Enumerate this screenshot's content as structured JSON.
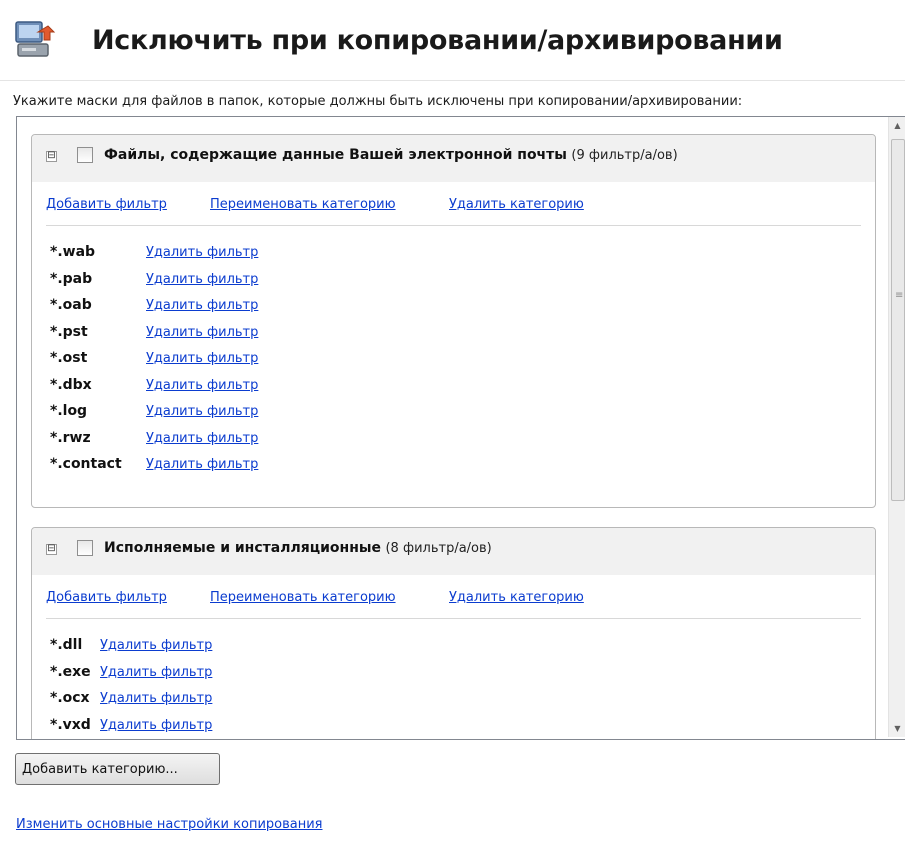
{
  "header": {
    "title": "Исключить при копировании/архивировании",
    "icon": "computer-backup-icon"
  },
  "instructions": "Укажите маски для файлов в папок, которые должны быть исключены при копировании/архивировании:",
  "action_labels": {
    "add_filter": "Добавить фильтр",
    "rename_category": "Переименовать категорию",
    "delete_category": "Удалить категорию",
    "delete_filter": "Удалить фильтр"
  },
  "categories": [
    {
      "title": "Файлы, содержащие данные Вашей электронной почты",
      "count": "(9 фильтр/а/ов)",
      "expander": "⊟",
      "checked": false,
      "filters": [
        "*.wab",
        "*.pab",
        "*.oab",
        "*.pst",
        "*.ost",
        "*.dbx",
        "*.log",
        "*.rwz",
        "*.contact"
      ]
    },
    {
      "title": "Исполняемые и инсталляционные",
      "count": "(8 фильтр/а/ов)",
      "expander": "⊟",
      "checked": false,
      "filters": [
        "*.dll",
        "*.exe",
        "*.ocx",
        "*.vxd"
      ]
    }
  ],
  "add_category_button": "Добавить категорию...",
  "bottom_link": "Изменить основные настройки копирования",
  "colors": {
    "link": "#0b3ccf",
    "category_header": "#f1f1f1",
    "border": "#b8b8b8"
  }
}
